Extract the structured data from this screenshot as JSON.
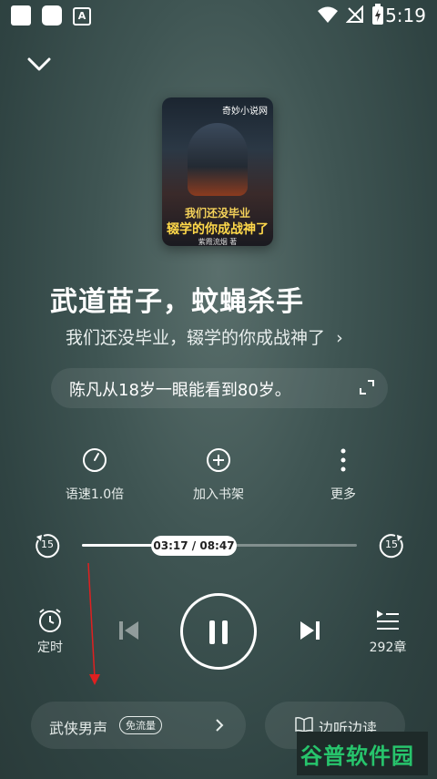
{
  "status_bar": {
    "time": "5:19",
    "a_label": "A"
  },
  "book": {
    "chapter_title": "武道苗子，蚊蝇杀手",
    "book_title": "我们还没毕业，辍学的你成战神了",
    "book_title_chevron": "›",
    "summary": "陈凡从18岁一眼能看到80岁。",
    "cover": {
      "brand": "奇妙小说网",
      "line1": "我们还没毕业",
      "line2": "辍学的你成战神了",
      "author": "紫霞流烟 著"
    }
  },
  "actions": [
    {
      "label": "语速1.0倍",
      "icon": "speed-gauge-icon"
    },
    {
      "label": "加入书架",
      "icon": "add-circle-icon"
    },
    {
      "label": "更多",
      "icon": "more-vertical-icon"
    }
  ],
  "player": {
    "time_display": "03:17 / 08:47",
    "progress": 0.37,
    "rewind_label": "15",
    "forward_label": "15",
    "timer_label": "定时",
    "chapters_label": "292章"
  },
  "bottom": {
    "voice_label": "武侠男声",
    "voice_badge": "免流量",
    "read_label": "边听边读"
  },
  "watermark": "谷普软件园",
  "colors": {
    "background": "#3f5553",
    "annotation_arrow": "#e02020",
    "watermark": "#27c46c"
  }
}
